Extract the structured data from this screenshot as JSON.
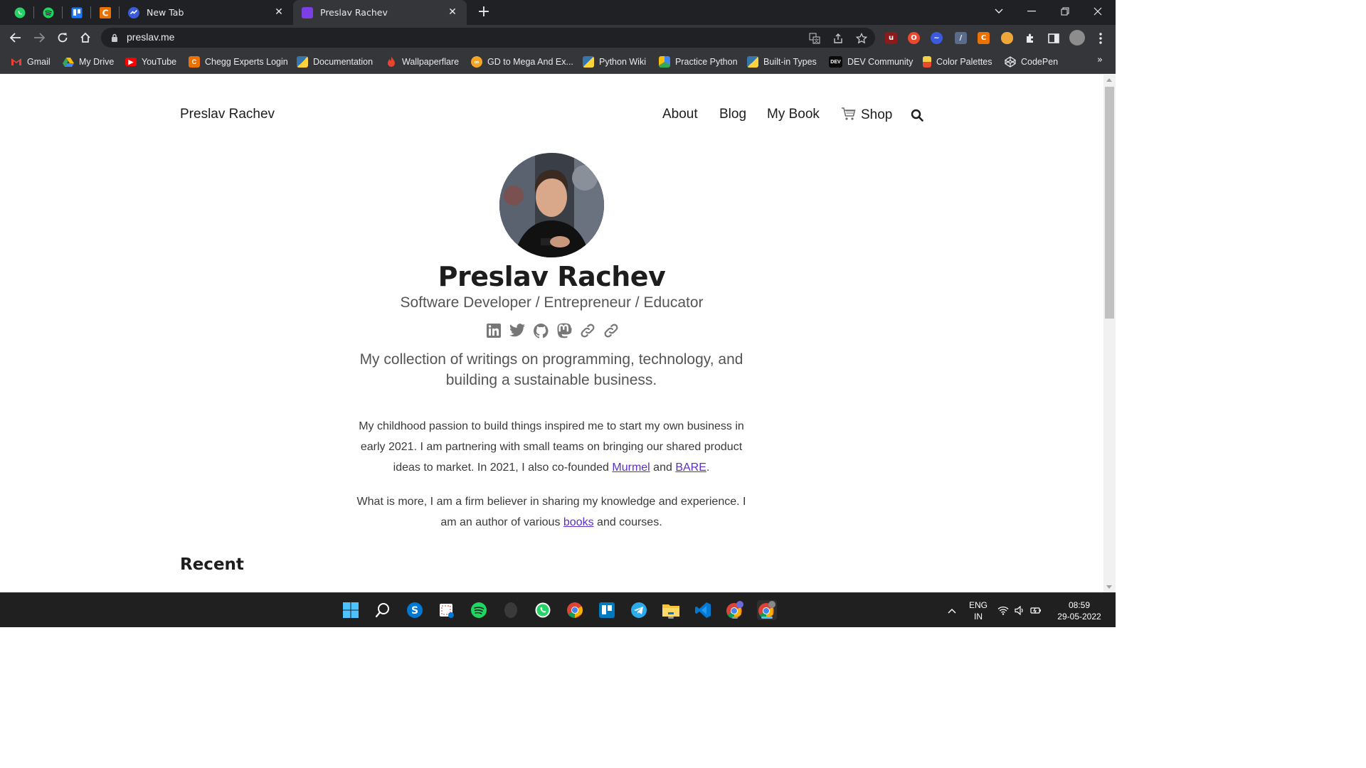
{
  "browser": {
    "tabs": [
      {
        "title": "New Tab",
        "active": false
      },
      {
        "title": "Preslav Rachev",
        "active": true
      }
    ],
    "tab_close_glyph": "✕",
    "new_tab_glyph": "+",
    "address": "preslav.me",
    "bookmarks": [
      {
        "label": "Gmail",
        "icon": "gmail-icon"
      },
      {
        "label": "My Drive",
        "icon": "drive-icon"
      },
      {
        "label": "YouTube",
        "icon": "youtube-icon"
      },
      {
        "label": "Chegg Experts Login",
        "icon": "chegg-icon"
      },
      {
        "label": "Documentation",
        "icon": "python-icon"
      },
      {
        "label": "Wallpaperflare",
        "icon": "flame-icon"
      },
      {
        "label": "GD to Mega And Ex...",
        "icon": "gd-icon"
      },
      {
        "label": "Python Wiki",
        "icon": "python-icon"
      },
      {
        "label": "Practice Python",
        "icon": "practice-python-icon"
      },
      {
        "label": "Built-in Types",
        "icon": "python-icon"
      },
      {
        "label": "DEV Community",
        "icon": "dev-icon"
      },
      {
        "label": "Color Palettes",
        "icon": "palette-icon"
      },
      {
        "label": "CodePen",
        "icon": "codepen-icon"
      }
    ],
    "bookmarks_more": "»",
    "dev_badge": "DEV"
  },
  "site": {
    "brand": "Preslav Rachev",
    "nav": [
      "About",
      "Blog",
      "My Book",
      "Shop"
    ],
    "hero_name": "Preslav Rachev",
    "hero_subtitle": "Software Developer / Entrepreneur / Educator",
    "tagline": "My collection of writings on programming, technology, and building a sustainable business.",
    "para1": {
      "text_before": "My childhood passion to build things inspired me to start my own business in early 2021. I am partnering with small teams on bringing our shared product ideas to market. In 2021, I also co-founded ",
      "link1": "Murmel",
      "text_mid": " and ",
      "link2": "BARE",
      "text_after": "."
    },
    "para2": {
      "text_before": "What is more, I am a firm believer in sharing my knowledge and experience. I am an author of various ",
      "link": "books",
      "text_after": " and courses."
    },
    "recent_heading": "Recent",
    "social_icons": [
      "linkedin-icon",
      "twitter-icon",
      "github-icon",
      "mastodon-icon",
      "link-icon",
      "link-icon"
    ],
    "link_color": "#5b2fc9"
  },
  "taskbar": {
    "language": "ENG",
    "region": "IN",
    "time": "08:59",
    "date": "29-05-2022"
  }
}
